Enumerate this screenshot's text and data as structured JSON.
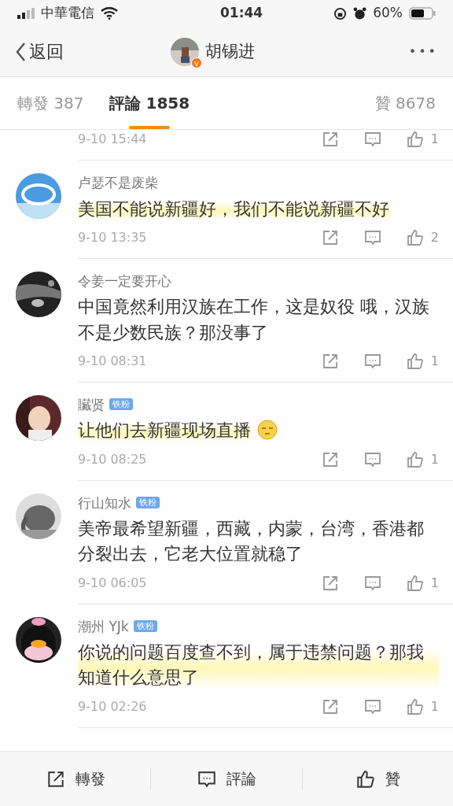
{
  "status_bar": {
    "carrier": "中華電信",
    "time": "01:44",
    "battery": "60%"
  },
  "header": {
    "back": "返回",
    "title": "胡锡进",
    "verified_badge": "v",
    "more": "•••"
  },
  "tabs": [
    {
      "label": "轉發 387",
      "selected": false
    },
    {
      "label": "評論 1858",
      "selected": true
    },
    {
      "label": "贊 8678",
      "selected": false
    }
  ],
  "comments": [
    {
      "kind": "cut",
      "time": "9-10 15:44",
      "likes": "1"
    },
    {
      "kind": "full",
      "name": "卢瑟不是废柴",
      "text": "美国不能说新疆好，我们不能说新疆不好",
      "highlighted": true,
      "sticker": false,
      "time": "9-10 13:35",
      "likes": "2"
    },
    {
      "kind": "full",
      "name": "令姜一定要开心",
      "text": "中国竟然利用汉族在工作，这是奴役 哦，汉族不是少数民族？那没事了",
      "highlighted": false,
      "sticker": false,
      "time": "9-10 08:31",
      "likes": "1"
    },
    {
      "kind": "full",
      "name": "贜贤",
      "badge": "铁粉",
      "text": "让他们去新疆现场直播",
      "highlighted": true,
      "sticker": true,
      "time": "9-10 08:25",
      "likes": "1"
    },
    {
      "kind": "full",
      "name": "行山知水",
      "badge": "铁粉",
      "text": "美帝最希望新疆，西藏，内蒙，台湾，香港都分裂出去，它老大位置就稳了",
      "highlighted": false,
      "sticker": false,
      "time": "9-10 06:05",
      "likes": "1"
    },
    {
      "kind": "full",
      "name": "潮州 YJk",
      "badge": "铁粉",
      "text": "你说的问题百度查不到，属于违禁问题？那我知道什么意思了",
      "highlighted": true,
      "sticker": false,
      "time": "9-10 02:26",
      "likes": "1"
    }
  ],
  "bottom_bar": [
    {
      "kind": "repost",
      "label": "轉發"
    },
    {
      "kind": "comment",
      "label": "評論"
    },
    {
      "kind": "like",
      "label": "贊"
    }
  ]
}
